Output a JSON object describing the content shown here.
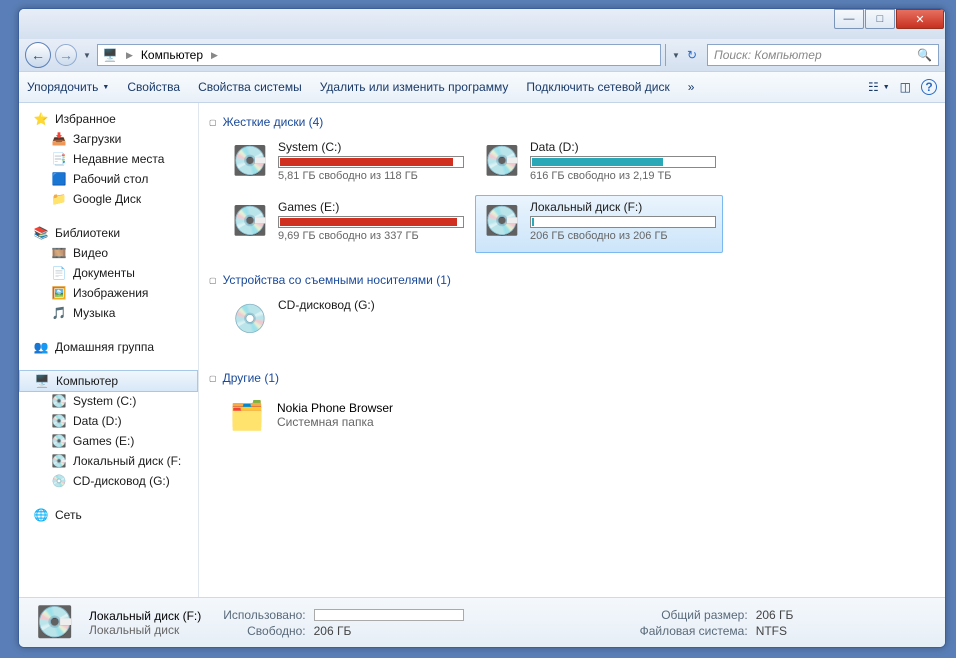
{
  "breadcrumb": {
    "root": "Компьютер"
  },
  "search": {
    "placeholder": "Поиск: Компьютер"
  },
  "toolbar": {
    "organize": "Упорядочить",
    "properties": "Свойства",
    "sysprops": "Свойства системы",
    "uninstall": "Удалить или изменить программу",
    "mapdrive": "Подключить сетевой диск",
    "more": "»"
  },
  "sidebar": {
    "favorites": {
      "label": "Избранное",
      "items": [
        "Загрузки",
        "Недавние места",
        "Рабочий стол",
        "Google Диск"
      ]
    },
    "libraries": {
      "label": "Библиотеки",
      "items": [
        "Видео",
        "Документы",
        "Изображения",
        "Музыка"
      ]
    },
    "homegroup": {
      "label": "Домашняя группа"
    },
    "computer": {
      "label": "Компьютер",
      "items": [
        "System (C:)",
        "Data (D:)",
        "Games (E:)",
        "Локальный диск (F:",
        "CD-дисковод (G:)"
      ]
    },
    "network": {
      "label": "Сеть"
    }
  },
  "groups": {
    "hdd": "Жесткие диски (4)",
    "removable": "Устройства со съемными носителями (1)",
    "other": "Другие (1)"
  },
  "drives": [
    {
      "name": "System (C:)",
      "free": "5,81 ГБ свободно из 118 ГБ",
      "fill": 95,
      "color": "#d03020"
    },
    {
      "name": "Data (D:)",
      "free": "616 ГБ свободно из 2,19 ТБ",
      "fill": 72,
      "color": "#2aa8b8"
    },
    {
      "name": "Games (E:)",
      "free": "9,69 ГБ свободно из 337 ГБ",
      "fill": 97,
      "color": "#d03020"
    },
    {
      "name": "Локальный диск (F:)",
      "free": "206 ГБ свободно из 206 ГБ",
      "fill": 1,
      "color": "#2aa8b8",
      "selected": true
    }
  ],
  "removable": {
    "name": "CD-дисковод (G:)"
  },
  "other": {
    "name": "Nokia Phone Browser",
    "sub": "Системная папка"
  },
  "status": {
    "title": "Локальный диск (F:)",
    "sub": "Локальный диск",
    "used_label": "Использовано:",
    "free_label": "Свободно:",
    "free_value": "206 ГБ",
    "total_label": "Общий размер:",
    "total_value": "206 ГБ",
    "fs_label": "Файловая система:",
    "fs_value": "NTFS"
  }
}
